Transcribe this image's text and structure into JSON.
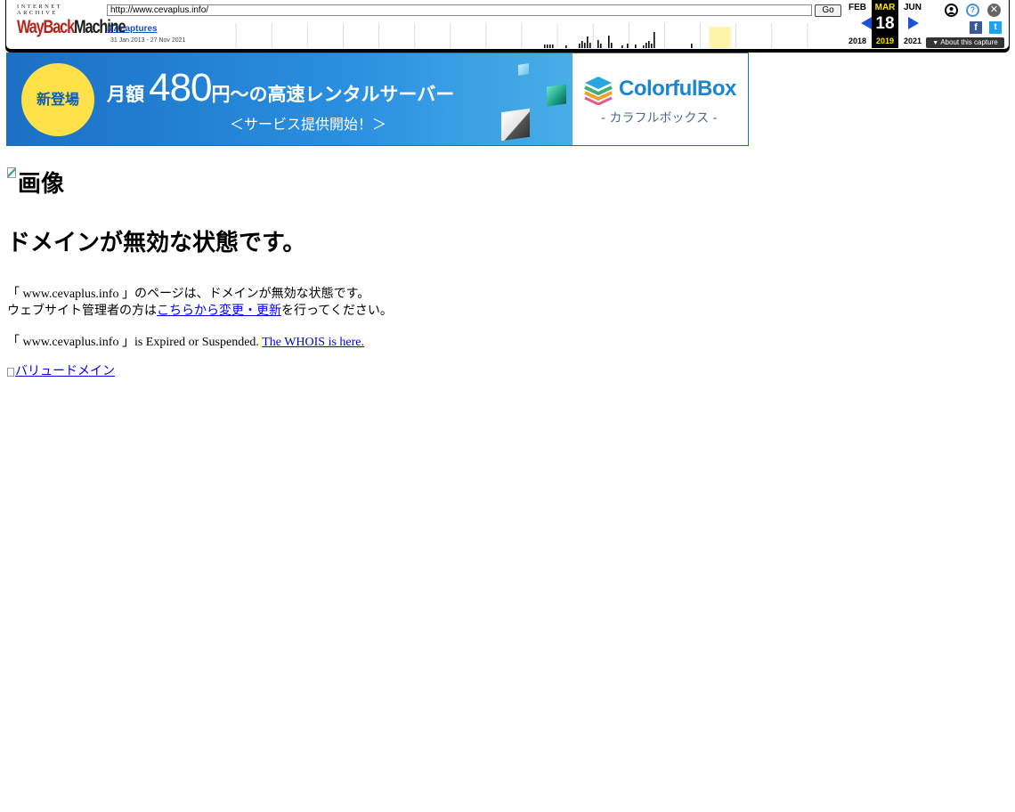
{
  "toolbar": {
    "logo_top": "INTERNET ARCHIVE",
    "logo_wayback": "WayBack",
    "logo_machine": "Machine",
    "url": "http://www.cevaplus.info/",
    "go_label": "Go",
    "captures_label": "47 captures",
    "date_range": "31 Jan 2013 - 27 Nov 2021",
    "prev_month": "FEB",
    "current_month": "MAR",
    "next_month": "JUN",
    "current_day": "18",
    "prev_year": "2018",
    "current_year": "2019",
    "next_year": "2021",
    "about_label": "About this capture",
    "sparkline_years": 18,
    "sparkline_highlight_year_index": 14
  },
  "banner": {
    "badge": "新登場",
    "price_prefix": "月額",
    "price_number": "480",
    "price_suffix": "円～の高速レンタルサーバー",
    "subline": "＜サービス提供開始！＞",
    "brand": "ColorfulBox",
    "brand_sub": "- カラフルボックス -",
    "colors": {
      "blue": "#1b70c4",
      "badge": "#ffe24a",
      "brand": "#1a86d0"
    }
  },
  "content": {
    "image_alt": "画像",
    "heading": "ドメインが無効な状態です。",
    "jp_line1": "「 www.cevaplus.info 」のページは、ドメインが無効な状態です。",
    "jp_line2_prefix": "ウェブサイト管理者の方は",
    "jp_line2_link": "こちらから変更・更新",
    "jp_line2_suffix": "を行ってください。",
    "en_prefix": "「 www.cevaplus.info 」is Expired or Suspended.",
    "en_link": "The WHOIS is here.",
    "bottom_link": "バリュードメイン"
  }
}
